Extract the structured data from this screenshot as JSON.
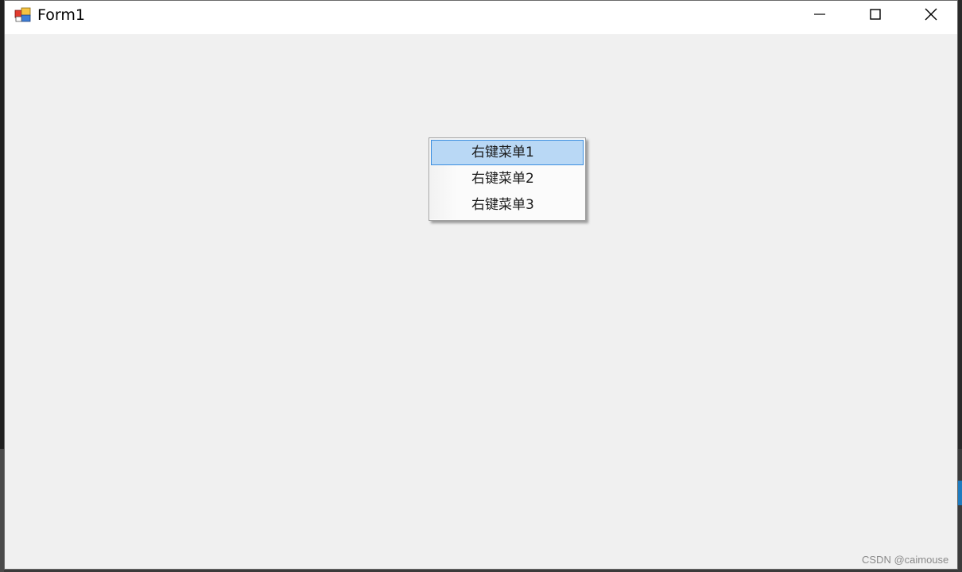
{
  "window": {
    "title": "Form1",
    "app_icon": "winforms-app-icon",
    "controls": {
      "minimize_icon": "minimize-icon",
      "maximize_icon": "maximize-icon",
      "close_icon": "close-icon"
    }
  },
  "context_menu": {
    "items": [
      {
        "label": "右键菜单1",
        "selected": true
      },
      {
        "label": "右键菜单2",
        "selected": false
      },
      {
        "label": "右键菜单3",
        "selected": false
      }
    ],
    "highlight_color": "#b9d8f5",
    "highlight_border_color": "#3b8ee0"
  },
  "watermark": {
    "text": "CSDN @caimouse"
  }
}
